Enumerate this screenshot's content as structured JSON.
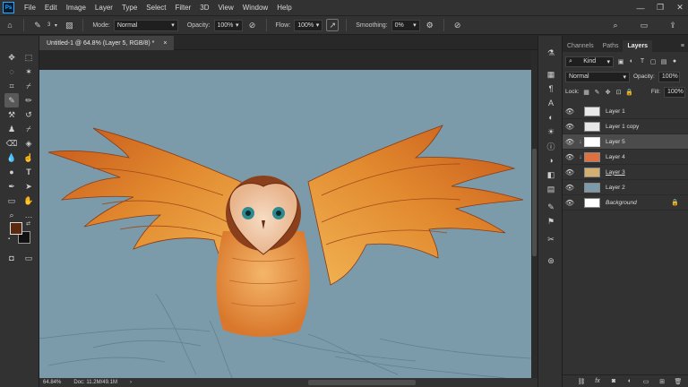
{
  "menu": [
    "File",
    "Edit",
    "Image",
    "Layer",
    "Type",
    "Select",
    "Filter",
    "3D",
    "View",
    "Window",
    "Help"
  ],
  "app_logo": "Ps",
  "options": {
    "brush_size": "3",
    "mode_label": "Mode:",
    "mode_value": "Normal",
    "opacity_label": "Opacity:",
    "opacity_value": "100%",
    "flow_label": "Flow:",
    "flow_value": "100%",
    "smoothing_label": "Smoothing:",
    "smoothing_value": "0%"
  },
  "document": {
    "tab_title": "Untitled-1 @ 64.8% (Layer 5, RGB/8) *",
    "close_glyph": "×"
  },
  "status": {
    "zoom": "64.84%",
    "doc": "Doc: 11.2M/49.1M"
  },
  "colors": {
    "foreground": "#5a2a10",
    "background": "#111111",
    "canvas": "#7b9aaa"
  },
  "panel": {
    "tabs": [
      "Channels",
      "Paths",
      "Layers"
    ],
    "active_tab": "Layers",
    "filter_kind": "Kind",
    "blend_mode": "Normal",
    "opacity_label": "Opacity:",
    "opacity_value": "100%",
    "lock_label": "Lock:",
    "fill_label": "Fill:",
    "fill_value": "100%",
    "layers": [
      {
        "name": "Layer 1",
        "thumb": "#e8e8e8",
        "clip": false,
        "selected": false,
        "style": ""
      },
      {
        "name": "Layer 1 copy",
        "thumb": "#e8e8e8",
        "clip": false,
        "selected": false,
        "style": ""
      },
      {
        "name": "Layer 5",
        "thumb": "#ffffff",
        "clip": true,
        "selected": true,
        "style": ""
      },
      {
        "name": "Layer 4",
        "thumb": "#e07040",
        "clip": true,
        "selected": false,
        "style": ""
      },
      {
        "name": "Layer 3",
        "thumb": "#d4b070",
        "clip": false,
        "selected": false,
        "style": "u"
      },
      {
        "name": "Layer 2",
        "thumb": "#7b9aaa",
        "clip": false,
        "selected": false,
        "style": ""
      },
      {
        "name": "Background",
        "thumb": "#ffffff",
        "clip": false,
        "selected": false,
        "style": "i"
      }
    ]
  }
}
